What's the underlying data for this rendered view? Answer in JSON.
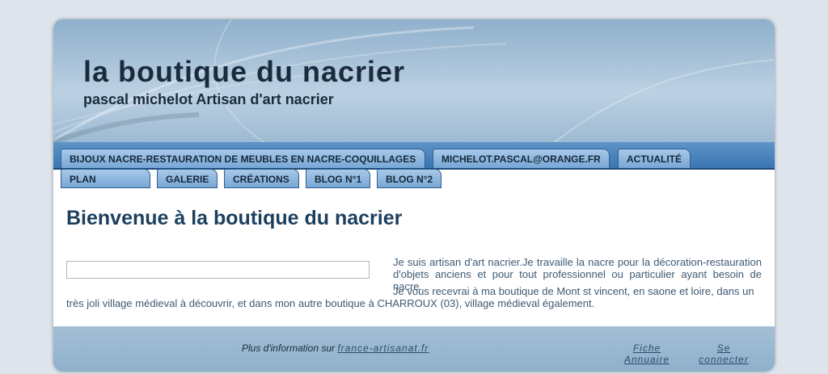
{
  "header": {
    "title": "la boutique du nacrier",
    "subtitle": "pascal michelot Artisan d'art nacrier"
  },
  "nav": {
    "row1": [
      "BIJOUX NACRE-RESTAURATION DE MEUBLES EN NACRE-COQUILLAGES",
      "MICHELOT.PASCAL@ORANGE.FR",
      "ACTUALITÉ"
    ],
    "row2": [
      "PLAN",
      "GALERIE",
      "CRÉATIONS",
      "BLOG N°1",
      "BLOG N°2"
    ]
  },
  "main": {
    "title": "Bienvenue à la boutique du nacrier",
    "search_value": "",
    "intro": "Je suis artisan d'art nacrier.Je travaille la nacre pour la décoration-restauration d'objets anciens et pour tout professionnel ou particulier ayant besoin de nacre.",
    "paragraph2_line1": "Je vous recevrai à ma boutique de Mont st vincent, en saone et loire, dans un",
    "paragraph2_line2": "très joli village médieval à découvrir, et dans mon autre boutique à CHARROUX (03), village médieval également."
  },
  "footer": {
    "info_text": "Plus d'information sur ",
    "info_link": "france-artisanat.fr",
    "fiche_line1": "Fiche",
    "fiche_line2": "Annuaire",
    "connect_line1": "Se",
    "connect_line2": "connecter"
  },
  "colors": {
    "nav_bar": "#3a76b3",
    "tab": "#8fb8e0",
    "title_text": "#1c3f5e",
    "body_text": "#3d5a73"
  }
}
